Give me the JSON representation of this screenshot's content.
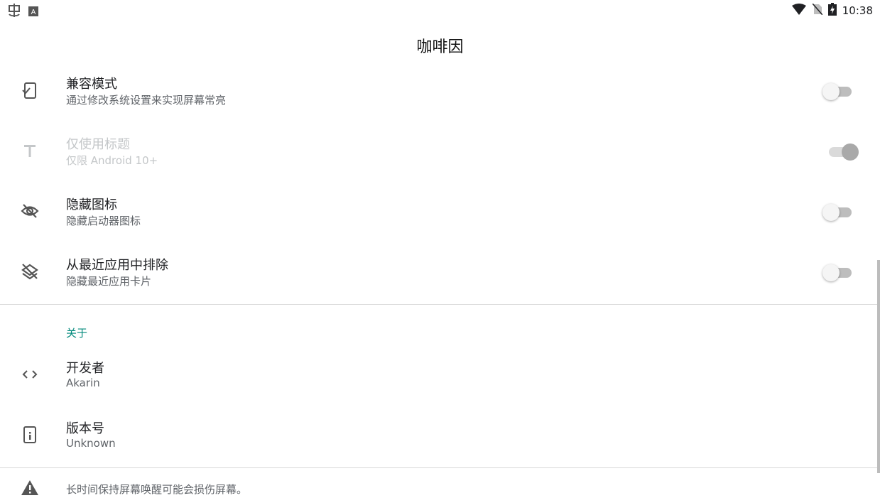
{
  "status_bar": {
    "left_icons": [
      "debug-icon",
      "keyboard-a-icon"
    ],
    "right_icons": [
      "wifi-icon",
      "no-sim-icon",
      "battery-charging-icon"
    ],
    "time": "10:38"
  },
  "app": {
    "title": "咖啡因"
  },
  "settings": [
    {
      "title": "兼容模式",
      "summary": "通过修改系统设置来实现屏幕常亮",
      "icon": "phone-check-icon",
      "switch": "off",
      "enabled": true
    },
    {
      "title": "仅使用标题",
      "summary": "仅限 Android 10+",
      "icon": "title-t-icon",
      "switch": "on",
      "enabled": false
    },
    {
      "title": "隐藏图标",
      "summary": "隐藏启动器图标",
      "icon": "eye-off-icon",
      "switch": "off",
      "enabled": true
    },
    {
      "title": "从最近应用中排除",
      "summary": "隐藏最近应用卡片",
      "icon": "layers-off-icon",
      "switch": "off",
      "enabled": true
    }
  ],
  "about": {
    "category": "关于",
    "developer": {
      "title": "开发者",
      "summary": "Akarin",
      "icon": "code-icon"
    },
    "version": {
      "title": "版本号",
      "summary": "Unknown",
      "icon": "info-icon"
    }
  },
  "footer": {
    "icon": "warning-icon",
    "text": "长时间保持屏幕唤醒可能会损伤屏幕。"
  },
  "colors": {
    "accent": "#00897b",
    "text_primary": "#202124",
    "text_secondary": "#5f6368",
    "disabled": "#c4c7c9"
  }
}
